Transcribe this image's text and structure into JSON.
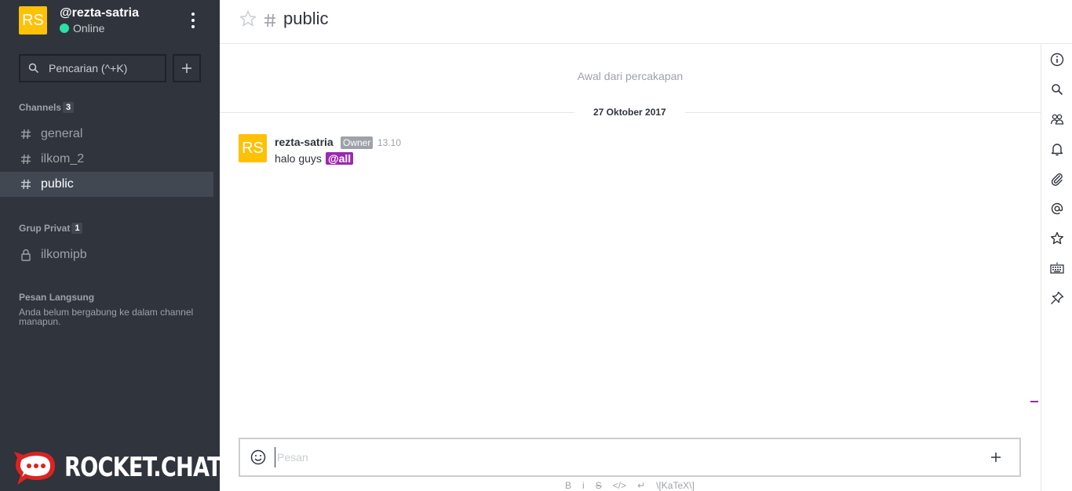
{
  "user": {
    "initials": "RS",
    "username": "@rezta-satria",
    "status": "Online",
    "status_color": "#2de0a5"
  },
  "search": {
    "placeholder": "Pencarian (^+K)"
  },
  "sidebar": {
    "channels_title": "Channels",
    "channels_count": "3",
    "channels": [
      {
        "name": "general",
        "icon": "hash-icon"
      },
      {
        "name": "ilkom_2",
        "icon": "hash-icon"
      },
      {
        "name": "public",
        "icon": "hash-icon",
        "active": true
      }
    ],
    "private_title": "Grup Privat",
    "private_count": "1",
    "private_groups": [
      {
        "name": "ilkomipb",
        "icon": "lock-icon"
      }
    ],
    "dm_title": "Pesan Langsung",
    "dm_empty": "Anda belum bergabung ke dalam channel manapun."
  },
  "brand": {
    "logo_text": "ROCKET.CHAT",
    "logo_color": "#db2323"
  },
  "room": {
    "name": "public"
  },
  "conversation": {
    "start_text": "Awal dari percakapan",
    "date": "27 Oktober 2017",
    "messages": [
      {
        "initials": "RS",
        "user": "rezta-satria",
        "role": "Owner",
        "time": "13.10",
        "text": "halo guys",
        "mention": "@all"
      }
    ]
  },
  "composer": {
    "placeholder": "Pesan"
  },
  "format_bar": [
    "B",
    "i",
    "S",
    "</>",
    "↵",
    "\\[KaTeX\\]"
  ],
  "right_toolbar": [
    "info-icon",
    "search-icon",
    "members-icon",
    "notification-bell-icon",
    "attachment-icon",
    "mention-icon",
    "star-icon",
    "keyboard-icon",
    "pin-icon"
  ],
  "colors": {
    "sidebar_bg": "#2f343d",
    "avatar": "#ffc107",
    "mention_bg": "#9c27b0"
  }
}
